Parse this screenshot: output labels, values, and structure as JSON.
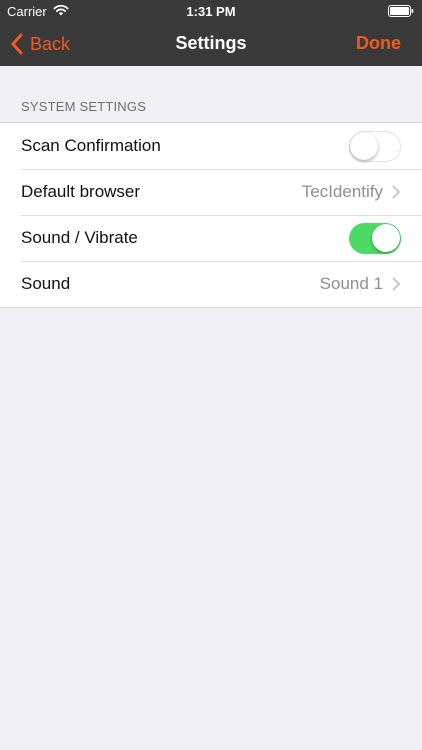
{
  "status_bar": {
    "carrier": "Carrier",
    "time": "1:31 PM"
  },
  "nav": {
    "back_label": "Back",
    "title": "Settings",
    "done_label": "Done"
  },
  "settings": {
    "section_title": "SYSTEM SETTINGS",
    "rows": [
      {
        "label": "Scan Confirmation",
        "control": "toggle",
        "on": false
      },
      {
        "label": "Default browser",
        "control": "disclosure",
        "value": "TecIdentify"
      },
      {
        "label": "Sound / Vibrate",
        "control": "toggle",
        "on": true
      },
      {
        "label": "Sound",
        "control": "disclosure",
        "value": "Sound 1"
      }
    ]
  },
  "colors": {
    "accent": "#f05a22",
    "toggle_on": "#4cd964",
    "nav_background": "#3a3a3a",
    "page_background": "#efeff4"
  },
  "icons": {
    "wifi": "wifi-icon",
    "battery": "battery-icon",
    "back": "chevron-left-icon",
    "disclosure": "chevron-right-icon"
  }
}
